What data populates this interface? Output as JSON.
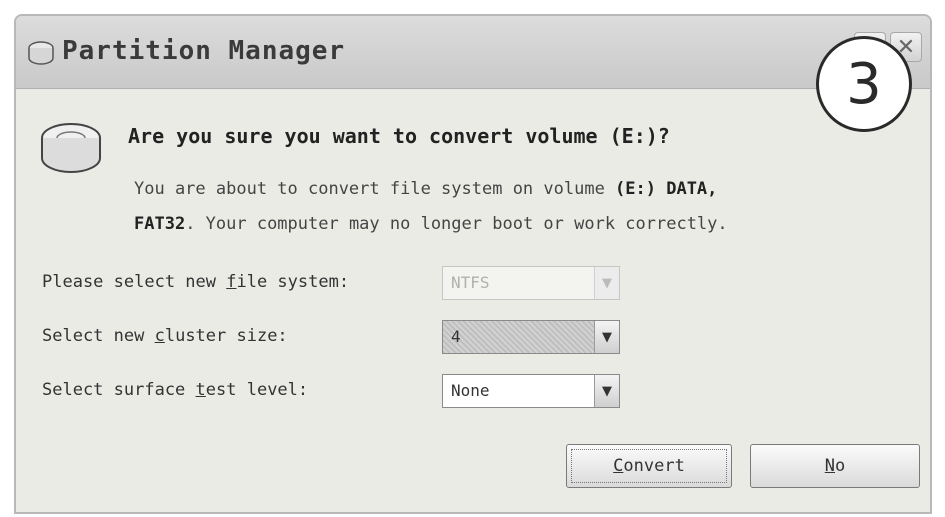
{
  "window": {
    "title": "Partition Manager"
  },
  "step_badge": "3",
  "dialog": {
    "question": "Are you sure you want to convert volume (E:)?",
    "desc_line1": {
      "prefix": "You are about to convert file system on volume ",
      "volume": "(E:) DATA,"
    },
    "desc_line2": {
      "fs": "FAT32",
      "suffix": ". Your computer may no longer boot or work correctly."
    }
  },
  "fields": {
    "file_system": {
      "label_pre": "Please select new ",
      "label_u": "f",
      "label_post": "ile system:",
      "value": "NTFS",
      "enabled": false
    },
    "cluster_size": {
      "label_pre": "Select new ",
      "label_u": "c",
      "label_post": "luster size:",
      "value": "4",
      "enabled": true
    },
    "surface_test": {
      "label_pre": "Select surface ",
      "label_u": "t",
      "label_post": "est level:",
      "value": "None",
      "enabled": true
    }
  },
  "buttons": {
    "convert": {
      "u": "C",
      "rest": "onvert"
    },
    "no": {
      "u": "N",
      "rest": "o"
    }
  },
  "icons": {
    "title": "disk-icon",
    "dialog": "disk-icon",
    "help": "question-icon",
    "close": "close-icon",
    "dropdown": "chevron-down-icon"
  }
}
